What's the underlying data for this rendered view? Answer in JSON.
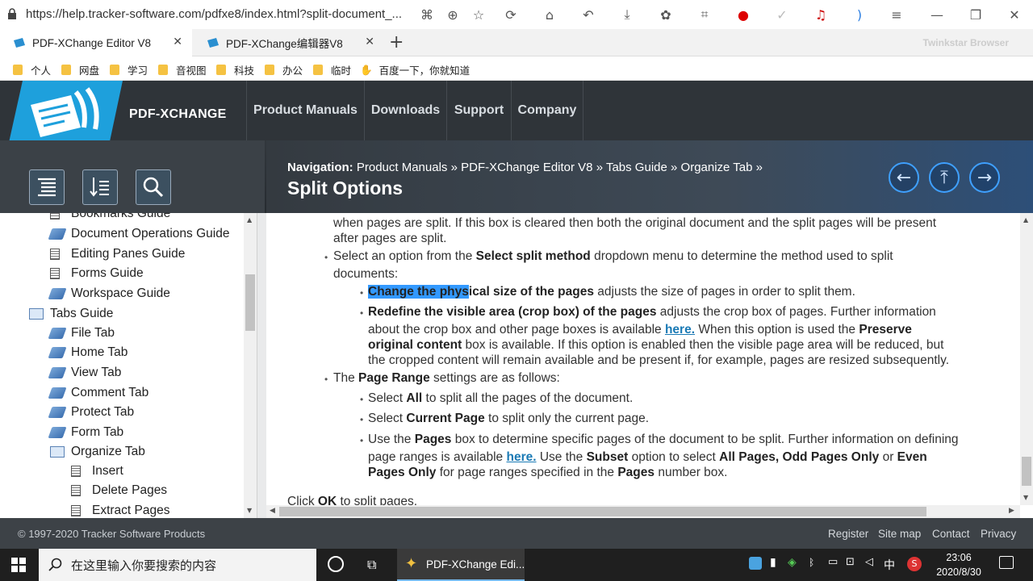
{
  "browser": {
    "url": "https://help.tracker-software.com/pdfxe8/index.html?split-document_...",
    "tabs": [
      {
        "label": "PDF-XChange Editor V8",
        "active": true
      },
      {
        "label": "PDF-XChange编辑器V8",
        "active": false
      }
    ],
    "brand": "Twinkstar Browser",
    "bookmarks": [
      "个人",
      "网盘",
      "学习",
      "音视图",
      "科技",
      "办公",
      "临时",
      "百度一下，你就知道"
    ]
  },
  "site": {
    "brand": "PDF-XCHANGE",
    "topnav": [
      "Product Manuals",
      "Downloads",
      "Support",
      "Company"
    ],
    "nav_label": "Navigation:",
    "breadcrumb": [
      "Product Manuals",
      "PDF-XChange Editor V8",
      "Tabs Guide",
      "Organize Tab"
    ],
    "breadcrumb_sep": "»",
    "page_title": "Split Options"
  },
  "sidebar": {
    "items": [
      {
        "label": "Bookmarks Guide",
        "icon": "doc"
      },
      {
        "label": "Document Operations Guide",
        "icon": "book"
      },
      {
        "label": "Editing Panes Guide",
        "icon": "doc"
      },
      {
        "label": "Forms Guide",
        "icon": "doc"
      },
      {
        "label": "Workspace Guide",
        "icon": "book"
      },
      {
        "label": "Tabs Guide",
        "icon": "openbook"
      },
      {
        "label": "File Tab",
        "icon": "book"
      },
      {
        "label": "Home Tab",
        "icon": "book"
      },
      {
        "label": "View Tab",
        "icon": "book"
      },
      {
        "label": "Comment Tab",
        "icon": "book"
      },
      {
        "label": "Protect Tab",
        "icon": "book"
      },
      {
        "label": "Form Tab",
        "icon": "book"
      },
      {
        "label": "Organize Tab",
        "icon": "openbook"
      },
      {
        "label": "Insert",
        "icon": "doc"
      },
      {
        "label": "Delete Pages",
        "icon": "doc"
      },
      {
        "label": "Extract Pages",
        "icon": "doc"
      }
    ]
  },
  "content": {
    "l1": "when pages are split. If this box is cleared then both the original document and the split pages will be present",
    "l2": "after pages are split.",
    "l3a": "Select an option from the ",
    "l3b": "Select split method",
    "l3c": " dropdown menu to determine the method used to split",
    "l4": "documents:",
    "l5hl": "Change the phys",
    "l5b": "ical size of the pages",
    "l5c": " adjusts the size of pages in order to split them.",
    "l6b": "Redefine the visible area (crop box) of the pages",
    "l6c": " adjusts the crop box of pages. Further information",
    "l7a": "about the crop box and other page boxes is available ",
    "l7link": "here.",
    "l7c": " When this option is used the ",
    "l7d": "Preserve",
    "l8b": "original content",
    "l8c": " box is available. If this option is enabled then the visible page area will be reduced, but",
    "l9": "the cropped content will remain available and be present if, for example, pages are resized subsequently.",
    "l10a": "The ",
    "l10b": "Page Range",
    "l10c": " settings are as follows:",
    "l11a": "Select ",
    "l11b": "All",
    "l11c": " to split all the pages of the document.",
    "l12a": "Select ",
    "l12b": "Current Page",
    "l12c": " to split only the current page.",
    "l13a": "Use the ",
    "l13b": "Pages",
    "l13c": " box to determine specific pages of the document to be split. Further information on defining",
    "l14a": "page ranges is available ",
    "l14link": "here.",
    "l14c": " Use the ",
    "l14d": "Subset",
    "l14e": " option to select ",
    "l14f": "All Pages, Odd Pages Only",
    "l14g": " or ",
    "l14h": "Even",
    "l15b": "Pages Only",
    "l15c": " for page ranges specified in the ",
    "l15d": "Pages",
    "l15e": " number box.",
    "l16a": "Click ",
    "l16b": "OK",
    "l16c": " to split pages."
  },
  "footer": {
    "copyright": "© 1997-2020 Tracker Software Products",
    "links": [
      "Register",
      "Site map",
      "Contact",
      "Privacy"
    ]
  },
  "taskbar": {
    "search_placeholder": "在这里输入你要搜索的内容",
    "app": "PDF-XChange Edi...",
    "time": "23:06",
    "date": "2020/8/30",
    "ime": "中"
  }
}
